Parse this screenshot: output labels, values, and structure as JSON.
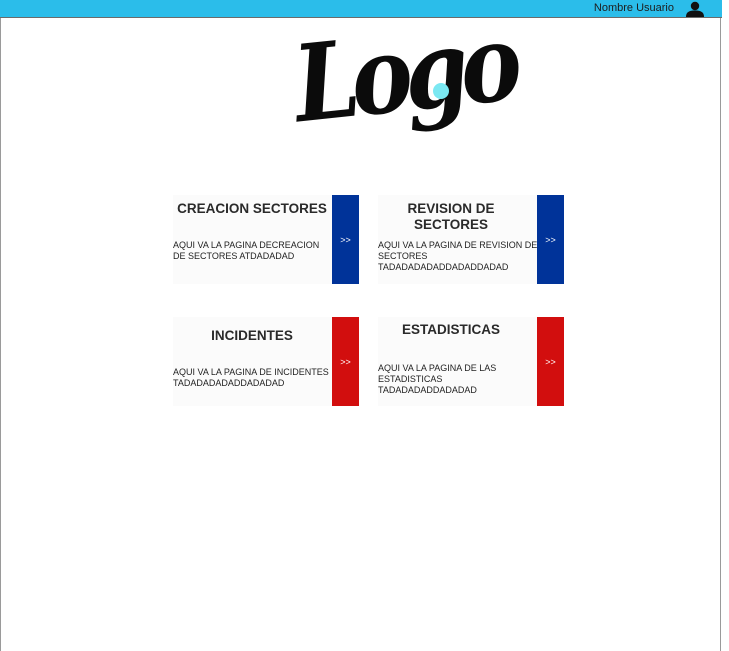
{
  "header": {
    "username": "Nombre Usuario",
    "user_icon": "user-icon",
    "bar_color": "#2bbdea"
  },
  "logo": {
    "text": "Logo",
    "dot_color": "#7be8f2"
  },
  "cards": [
    {
      "title": "CREACION SECTORES",
      "description": "AQUI VA LA PAGINA DECREACION DE SECTORES ATDADADAD",
      "arrow": ">>",
      "accent": "#003399"
    },
    {
      "title": "REVISION DE SECTORES",
      "description": "AQUI VA LA PAGINA DE REVISION DE SECTORES TADADADADADDADADDADAD",
      "arrow": ">>",
      "accent": "#003399"
    },
    {
      "title": "INCIDENTES",
      "description": "AQUI VA LA PAGINA DE INCIDENTES TADADADADADDADADAD",
      "arrow": ">>",
      "accent": "#d20e0e"
    },
    {
      "title": "ESTADISTICAS",
      "description": "AQUI VA LA PAGINA DE LAS ESTADISTICAS TADADADADDADADAD",
      "arrow": ">>",
      "accent": "#d20e0e"
    }
  ]
}
